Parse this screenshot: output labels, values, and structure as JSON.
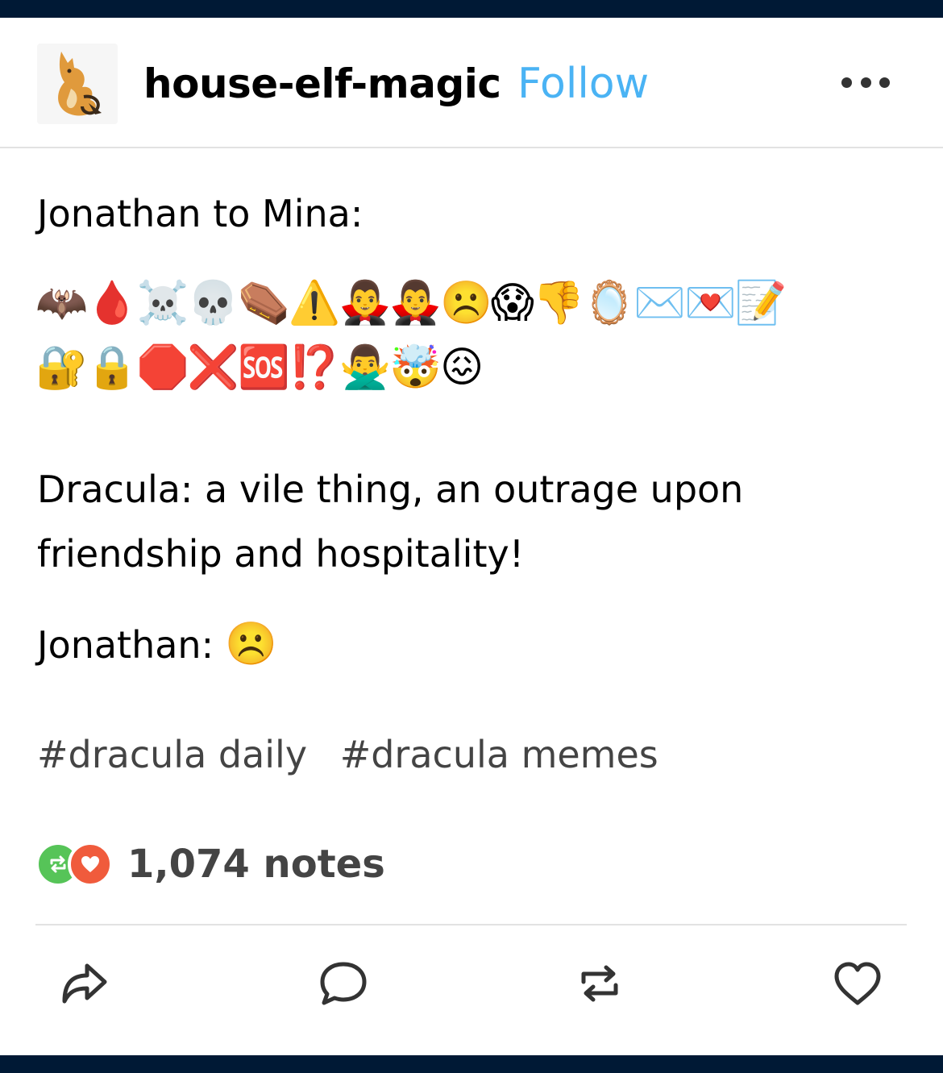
{
  "post": {
    "blog_name": "house-elf-magic",
    "follow_label": "Follow",
    "lines": [
      "Jonathan to Mina:",
      "Dracula: a vile thing, an outrage upon",
      "friendship and hospitality!",
      "Jonathan:"
    ],
    "emoji_row_1": "🦇🩸☠️💀⚰️⚠️🧛‍♂️🧛‍♂️☹️😱👎🪞✉️💌📝",
    "emoji_row_2": "🔐🔒🛑❌🆘⁉️🙅‍♂️🤯😖",
    "jonathan_face": "☹️",
    "tags": [
      "#dracula daily",
      "#dracula memes"
    ],
    "notes": "1,074 notes"
  },
  "colors": {
    "top_bar": "#001935",
    "follow": "#4ab3f4",
    "reblog": "#56c458",
    "like": "#f05b3c"
  },
  "icons": {
    "avatar": "fox-avatar",
    "more": "more-icon",
    "share": "share-icon",
    "reply": "reply-icon",
    "reblog": "reblog-icon",
    "like": "heart-icon"
  }
}
